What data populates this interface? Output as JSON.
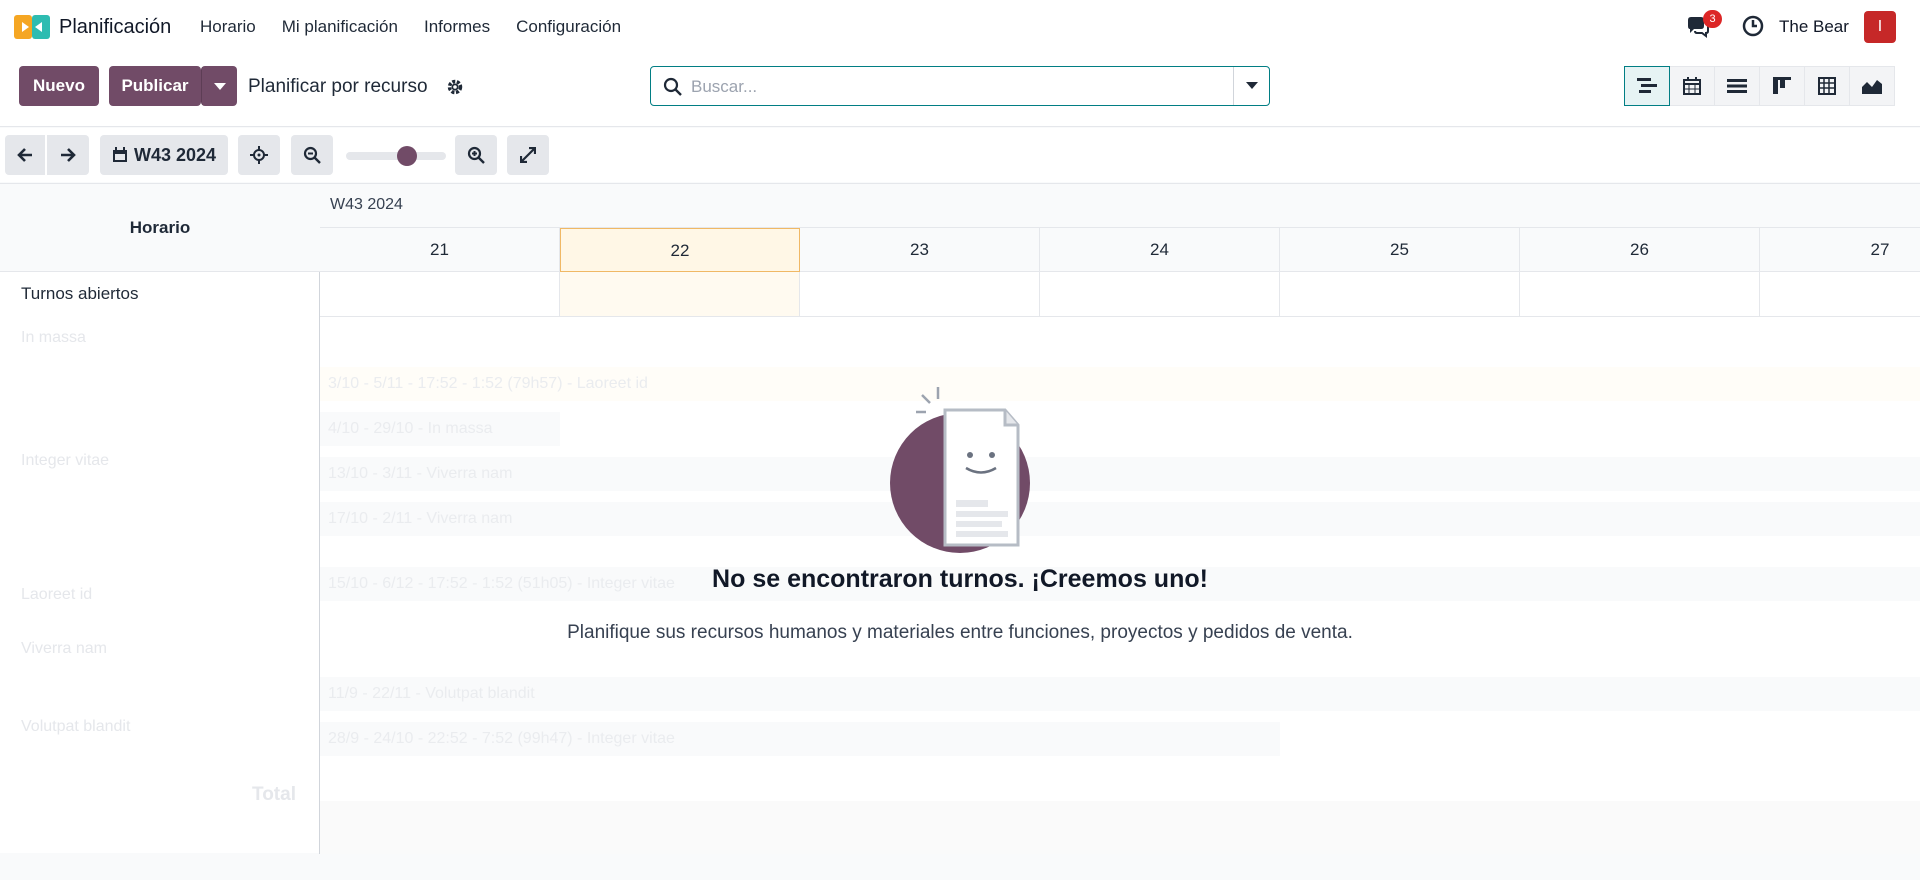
{
  "app": {
    "name": "Planificación",
    "logo_icon": "planning-logo-icon"
  },
  "menu": [
    "Horario",
    "Mi planificación",
    "Informes",
    "Configuración"
  ],
  "systray": {
    "messages_count": "3",
    "user_name": "The Bear",
    "avatar_initial": "I",
    "avatar_color": "#c62828"
  },
  "control": {
    "new_label": "Nuevo",
    "publish_label": "Publicar",
    "view_title": "Planificar por recurso",
    "search_placeholder": "Buscar...",
    "view_switcher": [
      "gantt-icon",
      "calendar-icon",
      "list-icon",
      "kanban-icon",
      "pivot-icon",
      "graph-icon"
    ]
  },
  "toolbar": {
    "week_label": "W43 2024",
    "zoom_level": 0.6
  },
  "gantt": {
    "row_header": "Horario",
    "week_label": "W43 2024",
    "days": [
      "21",
      "22",
      "23",
      "24",
      "25",
      "26",
      "27"
    ],
    "today_index": 1,
    "open_shifts_label": "Turnos abiertos",
    "ghost_rows": [
      "In massa",
      "Integer vitae",
      "Laoreet id",
      "Viverra nam",
      "Volutpat blandit"
    ],
    "ghost_pills": [
      "3/10 - 5/11 - 17:52 - 1:52 (79h57) - Laoreet id",
      "4/10 - 29/10 - In massa",
      "13/10 - 3/11 - Viverra nam",
      "17/10 - 2/11 - Viverra nam",
      "15/10 - 6/12 - 17:52 - 1:52 (51h05) - Integer vitae",
      "11/9 - 22/11 - Volutpat blandit",
      "28/9 - 24/10 - 22:52 - 7:52 (99h47) - Integer vitae"
    ],
    "total_label": "Total"
  },
  "empty_state": {
    "title": "No se encontraron turnos. ¡Creemos uno!",
    "subtitle": "Planifique sus recursos humanos y materiales entre funciones, proyectos y pedidos de venta."
  },
  "colors": {
    "brand": "#714b67",
    "accent": "#017e84",
    "today": "#fff7e6"
  }
}
